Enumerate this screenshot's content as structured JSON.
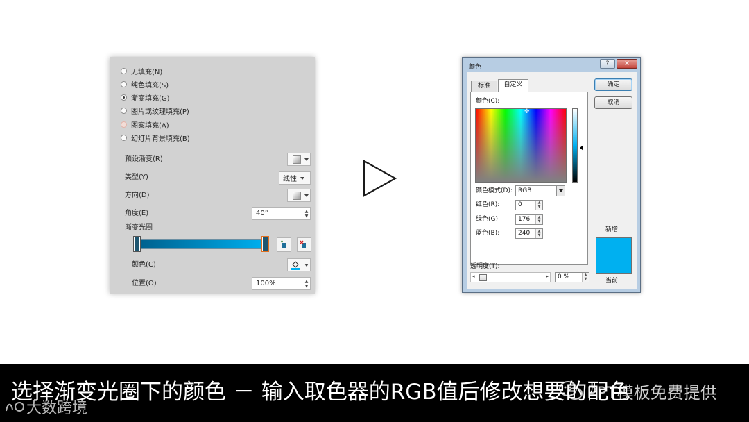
{
  "fill_panel": {
    "fill_options": [
      {
        "label": "无填充(N)",
        "selected": false
      },
      {
        "label": "纯色填充(S)",
        "selected": false
      },
      {
        "label": "渐变填充(G)",
        "selected": true
      },
      {
        "label": "图片或纹理填充(P)",
        "selected": false
      },
      {
        "label": "图案填充(A)",
        "selected": false
      },
      {
        "label": "幻灯片背景填充(B)",
        "selected": false
      }
    ],
    "preset_gradient_label": "预设渐变(R)",
    "type_label": "类型(Y)",
    "type_value": "线性",
    "direction_label": "方向(D)",
    "angle_label": "角度(E)",
    "angle_value": "40°",
    "gradient_stops_label": "渐变光圈",
    "color_label": "颜色(C)",
    "position_label": "位置(O)",
    "position_value": "100%"
  },
  "color_dialog": {
    "title": "颜色",
    "help_label": "?",
    "close_label": "✕",
    "tabs": [
      "标准",
      "自定义"
    ],
    "active_tab": "自定义",
    "colors_label": "颜色(C):",
    "color_model_label": "颜色模式(D):",
    "color_model_value": "RGB",
    "red_label": "红色(R):",
    "red_value": "0",
    "green_label": "绿色(G):",
    "green_value": "176",
    "blue_label": "蓝色(B):",
    "blue_value": "240",
    "ok_label": "确定",
    "cancel_label": "取消",
    "new_label": "新增",
    "current_label": "当前",
    "transparency_label": "透明度(T):",
    "transparency_value": "0 %"
  },
  "colors": {
    "selected_color": "#00B0F0",
    "gradient_start": "#005F8C",
    "gradient_end": "#00B0F0"
  },
  "subtitle": {
    "text": "选择渐变光圈下的颜色 － 输入取色器的RGB值后修改想要的配色",
    "wechat_overlay": "PPT模板免费提供",
    "corner_watermark": "大数跨境"
  }
}
